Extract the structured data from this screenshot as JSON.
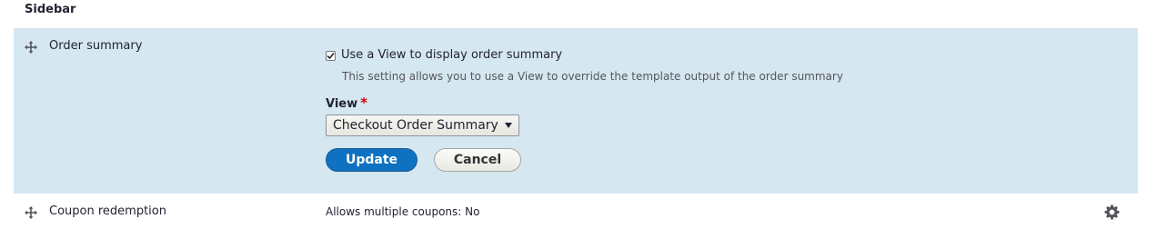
{
  "section": {
    "title": "Sidebar"
  },
  "rows": {
    "order_summary": {
      "label": "Order summary",
      "checkbox_label": "Use a View to display order summary",
      "checkbox_checked": true,
      "description": "This setting allows you to use a View to override the template output of the order summary",
      "view_label": "View",
      "required_mark": "*",
      "view_selected": "Checkout Order Summary",
      "update_label": "Update",
      "cancel_label": "Cancel"
    },
    "coupon": {
      "label": "Coupon redemption",
      "summary": "Allows multiple coupons: No"
    }
  },
  "icons": {
    "drag": "move-icon",
    "settings": "gear-icon",
    "check": "check-icon"
  },
  "colors": {
    "active_row_bg": "#d5e7f1",
    "primary_button": "#0f71c1",
    "required": "#e00000"
  }
}
